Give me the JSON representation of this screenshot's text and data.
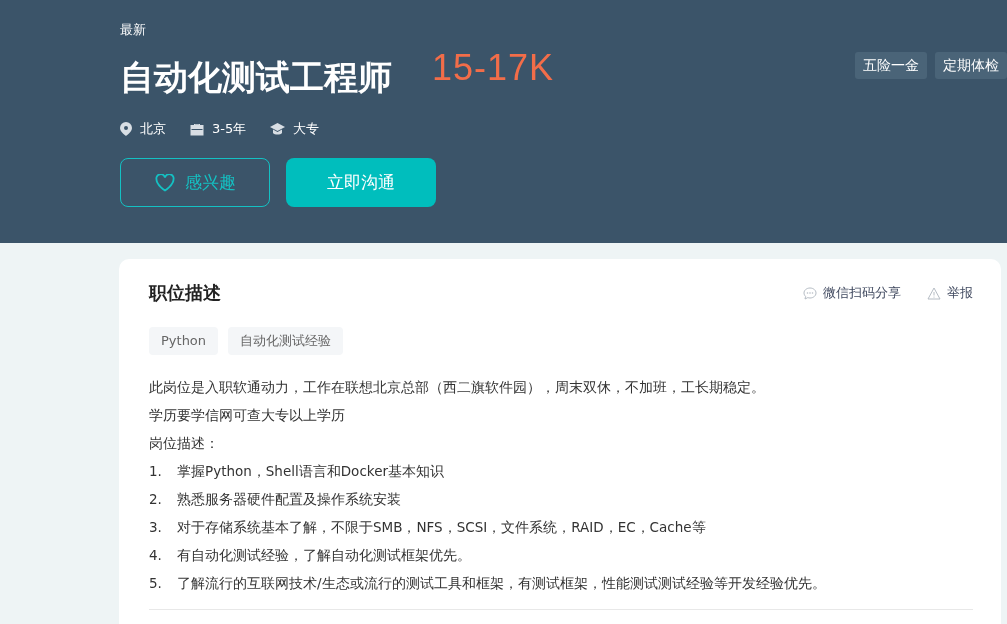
{
  "header": {
    "badge": "最新",
    "title": "自动化测试工程师",
    "salary": "15-17K",
    "benefits": [
      "五险一金",
      "定期体检"
    ],
    "meta": [
      {
        "kind": "location",
        "text": "北京"
      },
      {
        "kind": "experience",
        "text": "3-5年"
      },
      {
        "kind": "education",
        "text": "大专"
      }
    ],
    "interest_button": "感兴趣",
    "chat_button": "立即沟通"
  },
  "card": {
    "title": "职位描述",
    "share": "微信扫码分享",
    "report": "举报",
    "tags": [
      "Python",
      "自动化测试经验"
    ],
    "paragraphs": [
      "此岗位是入职软通动力，工作在联想北京总部（西二旗软件园），周末双休，不加班，工长期稳定。",
      "学历要学信网可查大专以上学历",
      "岗位描述："
    ],
    "items": [
      {
        "number": "1.",
        "text": "掌握Python，Shell语言和Docker基本知识"
      },
      {
        "number": "2.",
        "text": "熟悉服务器硬件配置及操作系统安装"
      },
      {
        "number": "3.",
        "text": "对于存储系统基本了解，不限于SMB，NFS，SCSI，文件系统，RAID，EC，Cache等"
      },
      {
        "number": "4.",
        "text": "有自动化测试经验，了解自动化测试框架优先。"
      },
      {
        "number": "5.",
        "text": "了解流行的互联网技术/生态或流行的测试工具和框架，有测试框架，性能测试测试经验等开发经验优先。"
      }
    ]
  }
}
